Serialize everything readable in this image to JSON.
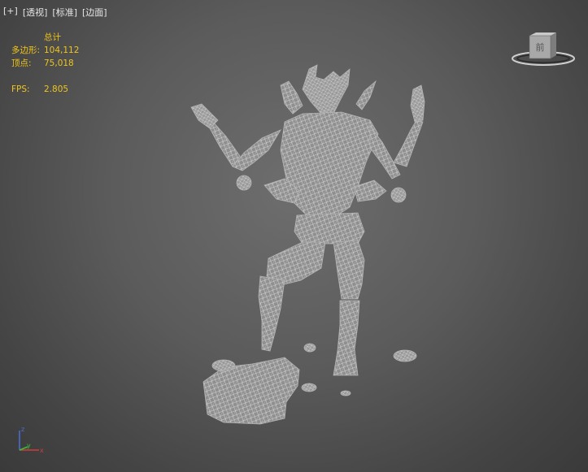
{
  "viewport": {
    "labels": [
      "[+]",
      "[透视]",
      "[标准]",
      "[边面]"
    ],
    "stats": {
      "header": "总计",
      "polygons_label": "多边形:",
      "polygons_value": "104,112",
      "vertices_label": "顶点:",
      "vertices_value": "75,018",
      "fps_label": "FPS:",
      "fps_value": "2.805"
    },
    "viewcube": {
      "face_label": "前"
    },
    "axis": {
      "x": "x",
      "y": "y",
      "z": "z"
    }
  },
  "colors": {
    "stats_text": "#f0c51a",
    "mesh": "#9a9a9a",
    "wire": "#c8c8c8",
    "axis_x": "#d23c3c",
    "axis_y": "#3cbf3c",
    "axis_z": "#4a6fd6"
  }
}
